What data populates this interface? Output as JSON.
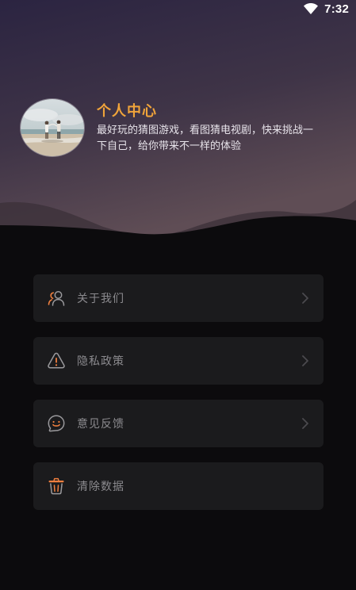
{
  "status": {
    "time": "7:32",
    "icons": [
      "wifi-icon"
    ]
  },
  "profile": {
    "title": "个人中心",
    "description": "最好玩的猜图游戏，看图猜电视剧，快来挑战一下自己，给你带来不一样的体验",
    "avatar": "couple-beach-photo"
  },
  "menu": {
    "items": [
      {
        "label": "关于我们",
        "icon": "people-icon",
        "chevron": true
      },
      {
        "label": "隐私政策",
        "icon": "warning-icon",
        "chevron": true
      },
      {
        "label": "意见反馈",
        "icon": "smile-chat-icon",
        "chevron": true
      },
      {
        "label": "清除数据",
        "icon": "trash-icon",
        "chevron": false
      }
    ]
  },
  "colors": {
    "accent": "#f0a43a",
    "background": "#0c0b0d",
    "card": "#1b1b1d",
    "hero_top": "#2f2746",
    "hero_bottom": "#5a4a54"
  }
}
